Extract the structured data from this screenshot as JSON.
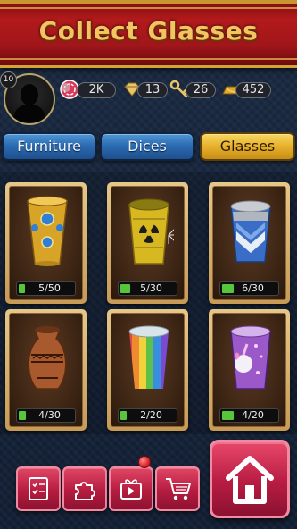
{
  "header": {
    "title": "Collect Glasses"
  },
  "player": {
    "level": "10"
  },
  "resources": [
    {
      "name": "chips",
      "icon": "poker-chip-icon",
      "value": "2K"
    },
    {
      "name": "gems",
      "icon": "gem-icon",
      "value": "13"
    },
    {
      "name": "keys",
      "icon": "key-icon",
      "value": "26"
    },
    {
      "name": "gold",
      "icon": "gold-bar-icon",
      "value": "452"
    }
  ],
  "tabs": [
    {
      "label": "Furniture",
      "active": false
    },
    {
      "label": "Dices",
      "active": false
    },
    {
      "label": "Glasses",
      "active": true
    }
  ],
  "glasses": [
    {
      "icon": "jeweled-gold-cup-icon",
      "progress": "5/50",
      "collected": 5,
      "total": 50
    },
    {
      "icon": "radioactive-cup-icon",
      "progress": "5/30",
      "collected": 5,
      "total": 30
    },
    {
      "icon": "blue-chevron-cup-icon",
      "progress": "6/30",
      "collected": 6,
      "total": 30
    },
    {
      "icon": "greek-vase-cup-icon",
      "progress": "4/30",
      "collected": 4,
      "total": 30
    },
    {
      "icon": "rainbow-cup-icon",
      "progress": "2/20",
      "collected": 2,
      "total": 20
    },
    {
      "icon": "unicorn-cup-icon",
      "progress": "4/20",
      "collected": 4,
      "total": 20
    }
  ],
  "colors": {
    "banner": "#a0161a",
    "banner_text": "#f4c463",
    "tab_blue": "#2c6cb2",
    "tab_gold": "#e6b02b",
    "progress_green": "#58c63a",
    "button_pink": "#b51c40"
  }
}
